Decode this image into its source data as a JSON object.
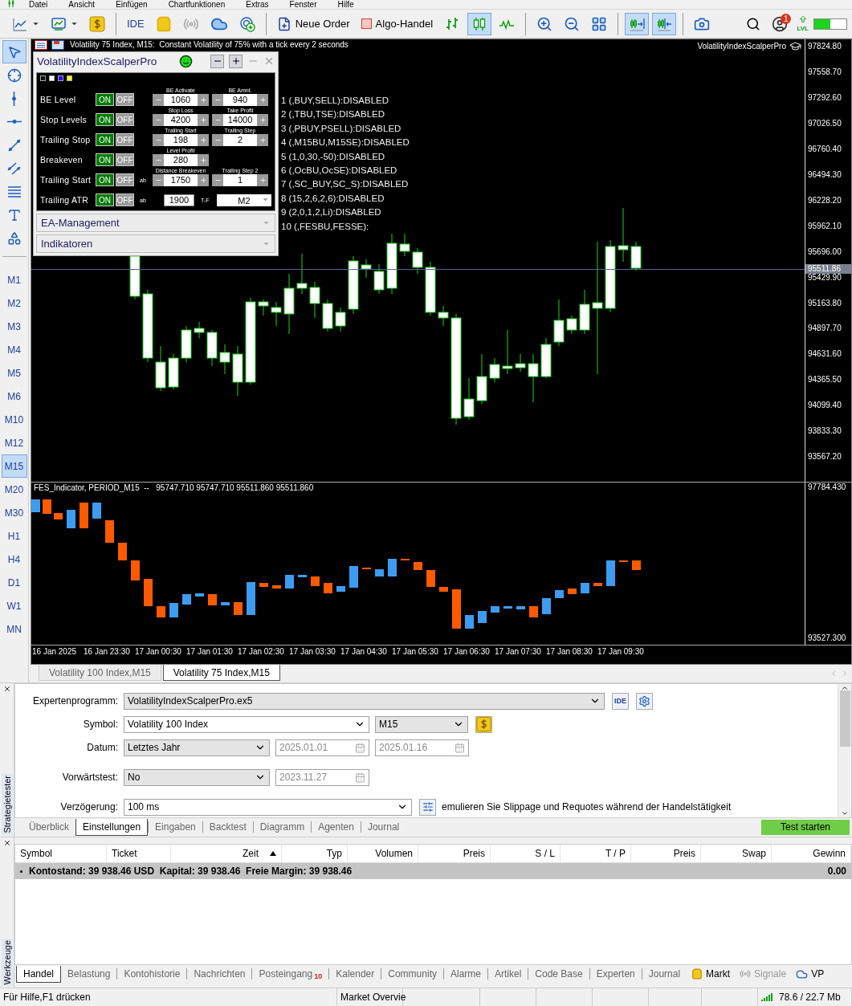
{
  "menu": [
    "Datei",
    "Ansicht",
    "Einfügen",
    "Chartfunktionen",
    "Extras",
    "Fenster",
    "Hilfe"
  ],
  "toolbar": {
    "ide": "IDE",
    "new_order": "Neue Order",
    "algo_trading": {
      "label": "Algo-Handel",
      "on": false
    },
    "candles_selected": true,
    "autoscroll_selected": true,
    "chart_shift_selected": true,
    "notification_count": "1",
    "level_label": "LVL"
  },
  "drawing_tools": [
    {
      "selected": true
    },
    {
      "selected": false
    },
    {
      "selected": false
    },
    {
      "selected": false
    },
    {
      "selected": false
    },
    {
      "selected": false
    },
    {
      "selected": false
    },
    {
      "selected": false
    },
    {
      "selected": false
    }
  ],
  "timeframes": [
    {
      "label": "M1",
      "selected": false
    },
    {
      "label": "M2",
      "selected": false
    },
    {
      "label": "M3",
      "selected": false
    },
    {
      "label": "M4",
      "selected": false
    },
    {
      "label": "M5",
      "selected": false
    },
    {
      "label": "M6",
      "selected": false
    },
    {
      "label": "M10",
      "selected": false
    },
    {
      "label": "M12",
      "selected": false
    },
    {
      "label": "M15",
      "selected": true
    },
    {
      "label": "M20",
      "selected": false
    },
    {
      "label": "M30",
      "selected": false
    },
    {
      "label": "H1",
      "selected": false
    },
    {
      "label": "H4",
      "selected": false
    },
    {
      "label": "D1",
      "selected": false
    },
    {
      "label": "W1",
      "selected": false
    },
    {
      "label": "MN",
      "selected": false
    }
  ],
  "chart": {
    "title": "Volatility 75 Index, M15:  Constant Volatility of 75% with a tick every 2 seconds",
    "expert_name": "VolatilityIndexScalperPro",
    "price_labels": [
      "97824.80",
      "97558.70",
      "97292.60",
      "97026.50",
      "96760.40",
      "96494.30",
      "96228.20",
      "95962.10",
      "95696.00",
      "95429.90",
      "95163.80",
      "94897.70",
      "94631.60",
      "94365.50",
      "94099.40",
      "93833.30",
      "93567.20"
    ],
    "current_price": "95511.86",
    "status_lines": [
      "1 (,BUY,SELL):DISABLED",
      "2 (,TBU,TSE):DISABLED",
      "3 (,PBUY,PSELL):DISABLED",
      "4 (,M15BU,M15SE):DISABLED",
      "5 (1,0,30,-50):DISABLED",
      "6 (,OcBU,OcSE):DISABLED",
      "7 (,SC_BUY,SC_S):DISABLED",
      "8 (15,2,6,2,6):DISABLED",
      "9 (2,0,1,2,Li):DISABLED",
      "10 (,FESBU,FESSE):"
    ],
    "indicator": {
      "label": "FES_Indicator, PERIOD_M15  --   95747.710 95747.710 95511.860 95511.860",
      "price_labels": [
        "97784.430",
        "93527.300"
      ]
    },
    "time_labels": [
      "16 Jan 2025",
      "16 Jan 23:30",
      "17 Jan 00:30",
      "17 Jan 01:30",
      "17 Jan 02:30",
      "17 Jan 03:30",
      "17 Jan 04:30",
      "17 Jan 05:30",
      "17 Jan 06:30",
      "17 Jan 07:30",
      "17 Jan 08:30",
      "17 Jan 09:30"
    ]
  },
  "ea_panel": {
    "title": "VolatilityIndexScalperPro",
    "swatches": [
      {
        "color": "#000000"
      },
      {
        "color": "#ffffff"
      },
      {
        "color": "#3300ff"
      },
      {
        "color": "#ffff00"
      }
    ],
    "rows": [
      {
        "label": "BE Level",
        "on": true,
        "on_label": "ON",
        "off_label": "OFF",
        "fields": [
          {
            "kind": "stepper",
            "header": "BE Activate",
            "value": "1060"
          },
          {
            "kind": "stepper",
            "header": "BE Amnt.",
            "value": "940"
          }
        ]
      },
      {
        "label": "Stop Levels",
        "on": true,
        "on_label": "ON",
        "off_label": "OFF",
        "fields": [
          {
            "kind": "stepper",
            "header": "Stop Loss",
            "value": "4200"
          },
          {
            "kind": "stepper",
            "header": "Take Profit",
            "value": "14000"
          }
        ]
      },
      {
        "label": "Trailing Stop",
        "on": true,
        "on_label": "ON",
        "off_label": "OFF",
        "fields": [
          {
            "kind": "stepper",
            "header": "Trailing Start",
            "value": "198"
          },
          {
            "kind": "stepper",
            "header": "Trailing Step",
            "value": "2"
          }
        ]
      },
      {
        "label": "Breakeven",
        "on": true,
        "on_label": "ON",
        "off_label": "OFF",
        "fields": [
          {
            "kind": "stepper",
            "header": "Level Profit",
            "value": "280"
          }
        ]
      },
      {
        "label": "Trailing Start",
        "on": true,
        "on_label": "ON",
        "off_label": "OFF",
        "prefix": "ab",
        "fields": [
          {
            "kind": "stepper",
            "header": "Distance Breakeven",
            "value": "1750"
          },
          {
            "kind": "stepper",
            "header": "Trailing Step 2",
            "value": "1"
          }
        ]
      },
      {
        "label": "Trailing ATR",
        "on": true,
        "on_label": "ON",
        "off_label": "OFF",
        "prefix": "ab",
        "fields": [
          {
            "kind": "value",
            "value": "1900"
          },
          {
            "kind": "dropdown",
            "label": "T-F",
            "value": "M2"
          }
        ]
      }
    ],
    "sections": [
      {
        "label": "EA-Management",
        "expanded": false
      },
      {
        "label": "Indikatoren",
        "expanded": false
      }
    ]
  },
  "chart_tabs": [
    {
      "label": "Volatility 100 Index,M15",
      "selected": false
    },
    {
      "label": "Volatility 75 Index,M15",
      "selected": true
    }
  ],
  "tester": {
    "side_label": "Strategietester",
    "rows": [
      {
        "label": "Expertenprogramm:",
        "controls": [
          {
            "kind": "select",
            "value": "VolatilityIndexScalperPro.ex5"
          },
          {
            "kind": "ide_button",
            "label": "IDE"
          },
          {
            "kind": "settings_button"
          }
        ]
      },
      {
        "label": "Symbol:",
        "controls": [
          {
            "kind": "combo",
            "value": "Volatility 100 Index"
          },
          {
            "kind": "select",
            "value": "M15"
          },
          {
            "kind": "currency_button"
          }
        ]
      },
      {
        "label": "Datum:",
        "controls": [
          {
            "kind": "select",
            "value": "Letztes Jahr"
          },
          {
            "kind": "date",
            "value": "2025.01.01",
            "disabled": true
          },
          {
            "kind": "date",
            "value": "2025.01.16",
            "disabled": true
          }
        ]
      },
      {
        "label": "Vorwärtstest:",
        "controls": [
          {
            "kind": "select",
            "value": "No"
          },
          {
            "kind": "date",
            "value": "2023.11.27",
            "disabled": true
          }
        ]
      },
      {
        "label": "Verzögerung:",
        "controls": [
          {
            "kind": "combo",
            "value": "100 ms"
          },
          {
            "kind": "sliders_button"
          },
          {
            "kind": "note",
            "value": "emulieren Sie Slippage und Requotes während der Handelstätigkeit"
          }
        ]
      }
    ],
    "tabs": [
      {
        "label": "Überblick",
        "selected": false
      },
      {
        "label": "Einstellungen",
        "selected": true
      },
      {
        "label": "Eingaben",
        "selected": false
      },
      {
        "label": "Backtest",
        "selected": false
      },
      {
        "label": "Diagramm",
        "selected": false
      },
      {
        "label": "Agenten",
        "selected": false
      },
      {
        "label": "Journal",
        "selected": false
      }
    ],
    "start_button": "Test starten"
  },
  "toolbox": {
    "side_label": "Werkzeuge",
    "columns": [
      {
        "label": "Symbol",
        "sorted": false
      },
      {
        "label": "Ticket",
        "sorted": false
      },
      {
        "label": "Zeit",
        "sorted": true
      },
      {
        "label": "Typ",
        "sorted": false
      },
      {
        "label": "Volumen",
        "sorted": false
      },
      {
        "label": "Preis",
        "sorted": false
      },
      {
        "label": "S / L",
        "sorted": false
      },
      {
        "label": "T / P",
        "sorted": false
      },
      {
        "label": "Preis",
        "sorted": false
      },
      {
        "label": "Swap",
        "sorted": false
      },
      {
        "label": "Gewinn",
        "sorted": false
      }
    ],
    "summary": {
      "text": "Kontostand: 39 938.46 USD  Kapital: 39 938.46  Freie Margin: 39 938.46",
      "profit": "0.00"
    },
    "tabs": [
      {
        "label": "Handel",
        "selected": true
      },
      {
        "label": "Belastung",
        "selected": false
      },
      {
        "label": "Kontohistorie",
        "selected": false
      },
      {
        "label": "Nachrichten",
        "selected": false
      },
      {
        "label": "Posteingang",
        "selected": false,
        "badge": "10"
      },
      {
        "label": "Kalender",
        "selected": false
      },
      {
        "label": "Community",
        "selected": false
      },
      {
        "label": "Alarme",
        "selected": false
      },
      {
        "label": "Artikel",
        "selected": false
      },
      {
        "label": "Code Base",
        "selected": false
      },
      {
        "label": "Experten",
        "selected": false
      },
      {
        "label": "Journal",
        "selected": false
      }
    ],
    "extra_tabs": [
      {
        "label": "Markt",
        "disabled": false
      },
      {
        "label": "Signale",
        "disabled": true
      },
      {
        "label": "VP",
        "disabled": false
      }
    ]
  },
  "status_bar": {
    "cells": [
      "Für Hilfe,F1 drücken",
      "Market Overvie"
    ],
    "memory": "78.6 / 22.7 Mb"
  }
}
